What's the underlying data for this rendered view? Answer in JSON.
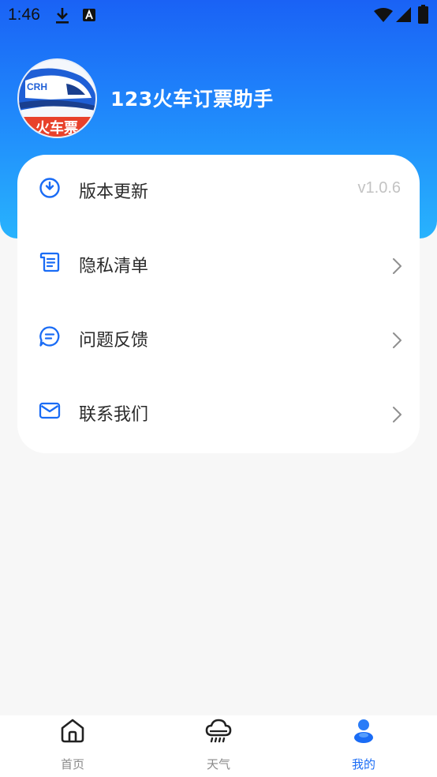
{
  "status_bar": {
    "time": "1:46",
    "icons": [
      "download-icon",
      "a-notification-icon",
      "wifi-icon",
      "signal-icon",
      "battery-icon"
    ]
  },
  "header": {
    "app_title": "123火车订票助手",
    "logo": {
      "top_text": "CRH",
      "bottom_text": "火车票"
    }
  },
  "menu": {
    "items": [
      {
        "icon": "update-clock-icon",
        "label": "版本更新",
        "value": "v1.0.6"
      },
      {
        "icon": "privacy-list-icon",
        "label": "隐私清单"
      },
      {
        "icon": "feedback-chat-icon",
        "label": "问题反馈"
      },
      {
        "icon": "mail-icon",
        "label": "联系我们"
      }
    ]
  },
  "tabbar": {
    "tabs": [
      {
        "icon": "home-icon",
        "label": "首页",
        "active": false
      },
      {
        "icon": "cloud-rain-icon",
        "label": "天气",
        "active": false
      },
      {
        "icon": "user-icon",
        "label": "我的",
        "active": true
      }
    ]
  },
  "colors": {
    "accent": "#1a6cf5",
    "header_gradient_top": "#1a62f5",
    "header_gradient_bottom": "#28b3fd",
    "background": "#f7f7f7",
    "text_primary": "#2b2b2b",
    "text_muted": "#c3c3c3",
    "tab_inactive": "#8a8a8a"
  }
}
